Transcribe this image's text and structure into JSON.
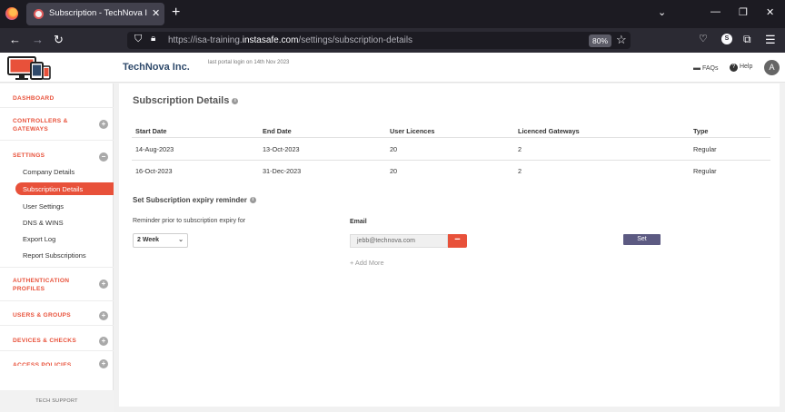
{
  "browser": {
    "tab_title": "Subscription - TechNova Inc. | In",
    "url_prefix": "https://isa-training.",
    "url_domain": "instasafe.com",
    "url_path": "/settings/subscription-details",
    "zoom": "80%",
    "profile_initial": "S"
  },
  "header": {
    "company": "TechNova Inc.",
    "last_login": "last portal login on 14th Nov 2023",
    "faqs": "FAQs",
    "help": "Help",
    "avatar_initial": "A"
  },
  "sidebar": {
    "dashboard": "DASHBOARD",
    "controllers_line1": "CONTROLLERS &",
    "controllers_line2": "GATEWAYS",
    "settings": "SETTINGS",
    "settings_items": [
      "Company Details",
      "Subscription Details",
      "User Settings",
      "DNS & WINS",
      "Export Log",
      "Report Subscriptions"
    ],
    "auth_line1": "AUTHENTICATION",
    "auth_line2": "PROFILES",
    "users_groups": "USERS & GROUPS",
    "devices_checks": "DEVICES & CHECKS",
    "access_policies": "ACCESS POLICIES",
    "tech_support": "TECH SUPPORT"
  },
  "main": {
    "title": "Subscription Details",
    "columns": [
      "Start Date",
      "End Date",
      "User Licences",
      "Licenced Gateways",
      "Type"
    ],
    "rows": [
      [
        "14-Aug-2023",
        "13-Oct-2023",
        "20",
        "2",
        "Regular"
      ],
      [
        "16-Oct-2023",
        "31-Dec-2023",
        "20",
        "2",
        "Regular"
      ]
    ],
    "reminder_title": "Set Subscription expiry reminder",
    "reminder_label": "Reminder prior to subscription expiry for",
    "reminder_value": "2 Week",
    "email_label": "Email",
    "email_value": "jebb@technova.com",
    "add_more": "Add More",
    "set_button": "Set"
  }
}
